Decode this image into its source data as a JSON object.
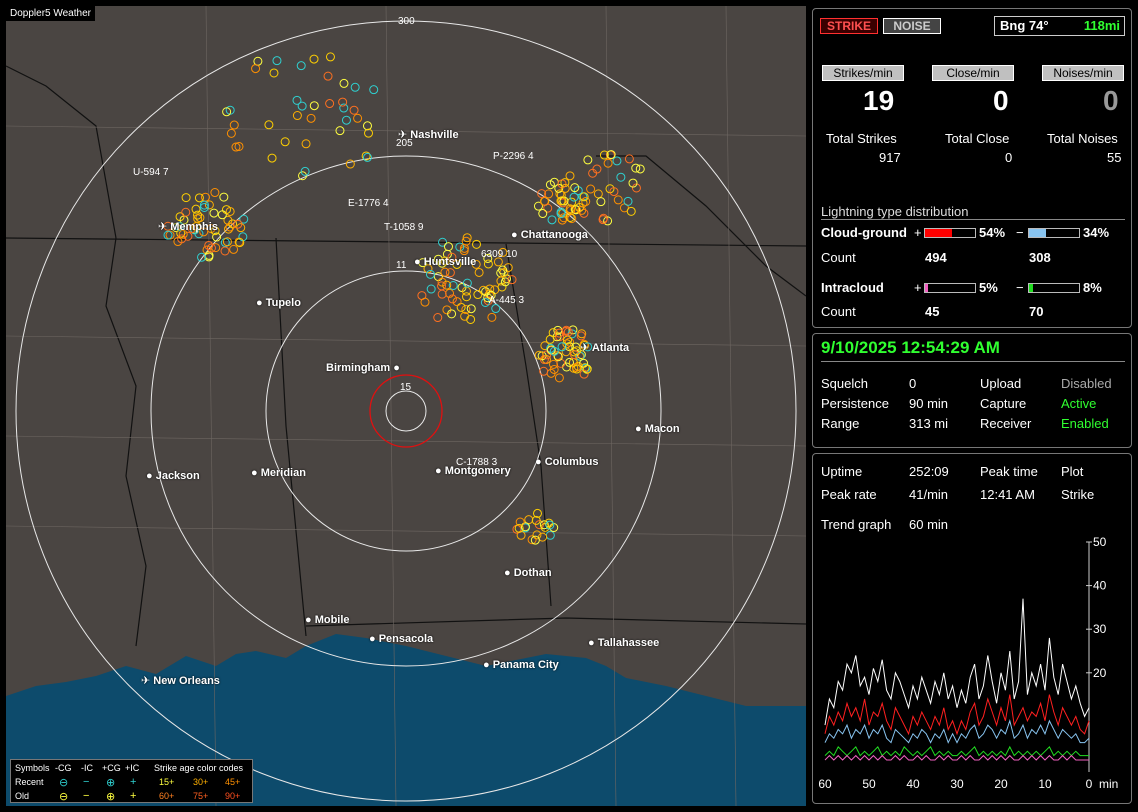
{
  "window": {
    "title": "Doppler5 Weather"
  },
  "map": {
    "range_labels": [
      "300",
      "205",
      "15"
    ],
    "cities": [
      {
        "name": "Nashville",
        "type": "airport"
      },
      {
        "name": "Memphis",
        "type": "airport"
      },
      {
        "name": "Chattanooga",
        "type": "city"
      },
      {
        "name": "Huntsville",
        "type": "city"
      },
      {
        "name": "Tupelo",
        "type": "city"
      },
      {
        "name": "Atlanta",
        "type": "airport"
      },
      {
        "name": "Birmingham",
        "type": "city"
      },
      {
        "name": "Macon",
        "type": "city"
      },
      {
        "name": "Jackson",
        "type": "city"
      },
      {
        "name": "Meridian",
        "type": "city"
      },
      {
        "name": "Montgomery",
        "type": "city"
      },
      {
        "name": "Columbus",
        "type": "city"
      },
      {
        "name": "Dothan",
        "type": "city"
      },
      {
        "name": "Mobile",
        "type": "city"
      },
      {
        "name": "Pensacola",
        "type": "city"
      },
      {
        "name": "Tallahassee",
        "type": "city"
      },
      {
        "name": "Panama City",
        "type": "city"
      },
      {
        "name": "New Orleans",
        "type": "airport"
      }
    ],
    "storm_tracks": [
      {
        "id": "U-594",
        "val": "7"
      },
      {
        "id": "P-2296",
        "val": "4"
      },
      {
        "id": "E-1776",
        "val": "4"
      },
      {
        "id": "T-1058",
        "val": "9"
      },
      {
        "id": "6309",
        "val": "10"
      },
      {
        "id": "A-445",
        "val": "3"
      },
      {
        "id": "C-1788",
        "val": "3"
      },
      {
        "id": "11",
        "val": ""
      }
    ],
    "legend": {
      "symbols_label": "Symbols",
      "col_cg_neg": "-CG",
      "col_ic_neg": "-IC",
      "col_cg_pos": "+CG",
      "col_ic_pos": "+IC",
      "age_title": "Strike age color codes",
      "recent_label": "Recent",
      "old_label": "Old",
      "recent_ages": [
        "15+",
        "30+",
        "45+"
      ],
      "old_ages": [
        "60+",
        "75+",
        "90+"
      ],
      "symbol_neg_cg": "⊖",
      "symbol_neg_ic": "−",
      "symbol_pos_cg": "⊕",
      "symbol_pos_ic": "+"
    }
  },
  "panel_top": {
    "strike_btn": "STRIKE",
    "noise_btn": "NOISE",
    "bearing_label": "Bng 74°",
    "bearing_dist": "118mi",
    "strikes_per_min_label": "Strikes/min",
    "close_per_min_label": "Close/min",
    "noises_per_min_label": "Noises/min",
    "strikes_per_min": "19",
    "close_per_min": "0",
    "noises_per_min": "0",
    "total_strikes_label": "Total Strikes",
    "total_close_label": "Total Close",
    "total_noises_label": "Total Noises",
    "total_strikes": "917",
    "total_close": "0",
    "total_noises": "55",
    "dist_title": "Lightning type distribution",
    "cg_label": "Cloud-ground",
    "ic_label": "Intracloud",
    "count_label": "Count",
    "plus": "+",
    "minus": "−",
    "cg_pos_pct": "54%",
    "cg_neg_pct": "34%",
    "cg_pos_count": "494",
    "cg_neg_count": "308",
    "ic_pos_pct": "5%",
    "ic_neg_pct": "8%",
    "ic_pos_count": "45",
    "ic_neg_count": "70",
    "cg_pos_fill": 0.54,
    "cg_neg_fill": 0.34,
    "ic_pos_fill": 0.05,
    "ic_neg_fill": 0.08,
    "colors": {
      "cg_pos": "#ff0000",
      "cg_neg": "#88c4f0",
      "ic_pos": "#f060c0",
      "ic_neg": "#22dd22"
    }
  },
  "panel_mid": {
    "datetime": "9/10/2025 12:54:29 AM",
    "squelch_label": "Squelch",
    "squelch": "0",
    "persistence_label": "Persistence",
    "persistence": "90 min",
    "range_label": "Range",
    "range": "313 mi",
    "upload_label": "Upload",
    "upload": "Disabled",
    "capture_label": "Capture",
    "capture": "Active",
    "receiver_label": "Receiver",
    "receiver": "Enabled"
  },
  "panel_bottom": {
    "uptime_label": "Uptime",
    "uptime": "252:09",
    "peak_time_label": "Peak time",
    "peak_time": "12:41 AM",
    "plot_label": "Plot",
    "plot": "Strike",
    "peak_rate_label": "Peak rate",
    "peak_rate": "41/min",
    "trend_label": "Trend graph",
    "trend": "60 min"
  },
  "chart_data": {
    "type": "line",
    "x": [
      60,
      59,
      58,
      57,
      56,
      55,
      54,
      53,
      52,
      51,
      50,
      49,
      48,
      47,
      46,
      45,
      44,
      43,
      42,
      41,
      40,
      39,
      38,
      37,
      36,
      35,
      34,
      33,
      32,
      31,
      30,
      29,
      28,
      27,
      26,
      25,
      24,
      23,
      22,
      21,
      20,
      19,
      18,
      17,
      16,
      15,
      14,
      13,
      12,
      11,
      10,
      9,
      8,
      7,
      6,
      5,
      4,
      3,
      2,
      1,
      0
    ],
    "xticks": [
      "60",
      "50",
      "40",
      "30",
      "20",
      "10",
      "0"
    ],
    "xunit": "min",
    "yticks": [
      "50",
      "40",
      "30",
      "20"
    ],
    "ylim": [
      0,
      50
    ],
    "series": [
      {
        "color": "#ffffff",
        "values": [
          8,
          14,
          12,
          18,
          16,
          22,
          20,
          24,
          17,
          19,
          15,
          21,
          18,
          23,
          16,
          14,
          20,
          18,
          15,
          12,
          17,
          14,
          19,
          16,
          13,
          18,
          15,
          20,
          14,
          17,
          12,
          16,
          13,
          19,
          22,
          14,
          17,
          24,
          18,
          13,
          20,
          16,
          25,
          14,
          18,
          37,
          15,
          20,
          17,
          22,
          16,
          28,
          19,
          15,
          22,
          18,
          14,
          17,
          13,
          10,
          12
        ]
      },
      {
        "color": "#ff2020",
        "values": [
          6,
          10,
          8,
          11,
          9,
          13,
          10,
          12,
          9,
          14,
          8,
          11,
          10,
          13,
          9,
          7,
          12,
          10,
          8,
          6,
          10,
          8,
          11,
          9,
          7,
          10,
          8,
          12,
          7,
          9,
          6,
          9,
          7,
          11,
          13,
          8,
          10,
          14,
          11,
          8,
          12,
          9,
          15,
          8,
          10,
          12,
          9,
          11,
          10,
          13,
          9,
          15,
          11,
          8,
          12,
          10,
          8,
          10,
          7,
          6,
          9
        ]
      },
      {
        "color": "#88c4f0",
        "values": [
          4,
          6,
          5,
          7,
          6,
          8,
          5,
          7,
          6,
          8,
          5,
          7,
          6,
          8,
          5,
          4,
          7,
          6,
          5,
          4,
          6,
          5,
          7,
          6,
          4,
          6,
          5,
          7,
          4,
          6,
          4,
          6,
          5,
          7,
          8,
          5,
          6,
          8,
          7,
          5,
          7,
          6,
          9,
          5,
          6,
          8,
          5,
          7,
          6,
          8,
          6,
          9,
          7,
          5,
          7,
          6,
          5,
          6,
          4,
          4,
          5
        ]
      },
      {
        "color": "#22dd22",
        "values": [
          1,
          2,
          1,
          3,
          2,
          1,
          2,
          3,
          1,
          2,
          1,
          2,
          3,
          1,
          2,
          1,
          2,
          1,
          3,
          2,
          1,
          2,
          1,
          2,
          3,
          1,
          2,
          1,
          2,
          1,
          1,
          2,
          1,
          2,
          3,
          1,
          2,
          1,
          2,
          1,
          2,
          1,
          3,
          1,
          2,
          1,
          2,
          1,
          2,
          1,
          2,
          3,
          1,
          2,
          1,
          2,
          1,
          2,
          1,
          1,
          1
        ]
      },
      {
        "color": "#f060c0",
        "values": [
          0,
          1,
          0,
          1,
          0,
          1,
          0,
          1,
          0,
          1,
          0,
          1,
          0,
          1,
          0,
          0,
          1,
          0,
          1,
          0,
          0,
          1,
          0,
          1,
          0,
          0,
          1,
          0,
          1,
          0,
          0,
          1,
          0,
          1,
          0,
          0,
          1,
          0,
          1,
          0,
          1,
          0,
          1,
          0,
          0,
          1,
          0,
          1,
          0,
          1,
          0,
          1,
          0,
          0,
          1,
          0,
          1,
          0,
          0,
          0,
          0
        ]
      }
    ]
  }
}
